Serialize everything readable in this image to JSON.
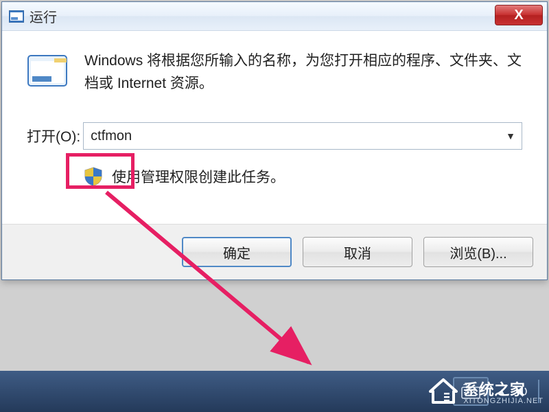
{
  "title": "运行",
  "close": "X",
  "description": "Windows 将根据您所输入的名称，为您打开相应的程序、文件夹、文档或 Internet 资源。",
  "open_label": "打开(O):",
  "open_value": "ctfmon",
  "admin_note": "使用管理权限创建此任务。",
  "buttons": {
    "ok": "确定",
    "cancel": "取消",
    "browse": "浏览(B)..."
  },
  "watermark": {
    "brand": "系统之家",
    "url": "XITONGZHIJIA.NET"
  }
}
